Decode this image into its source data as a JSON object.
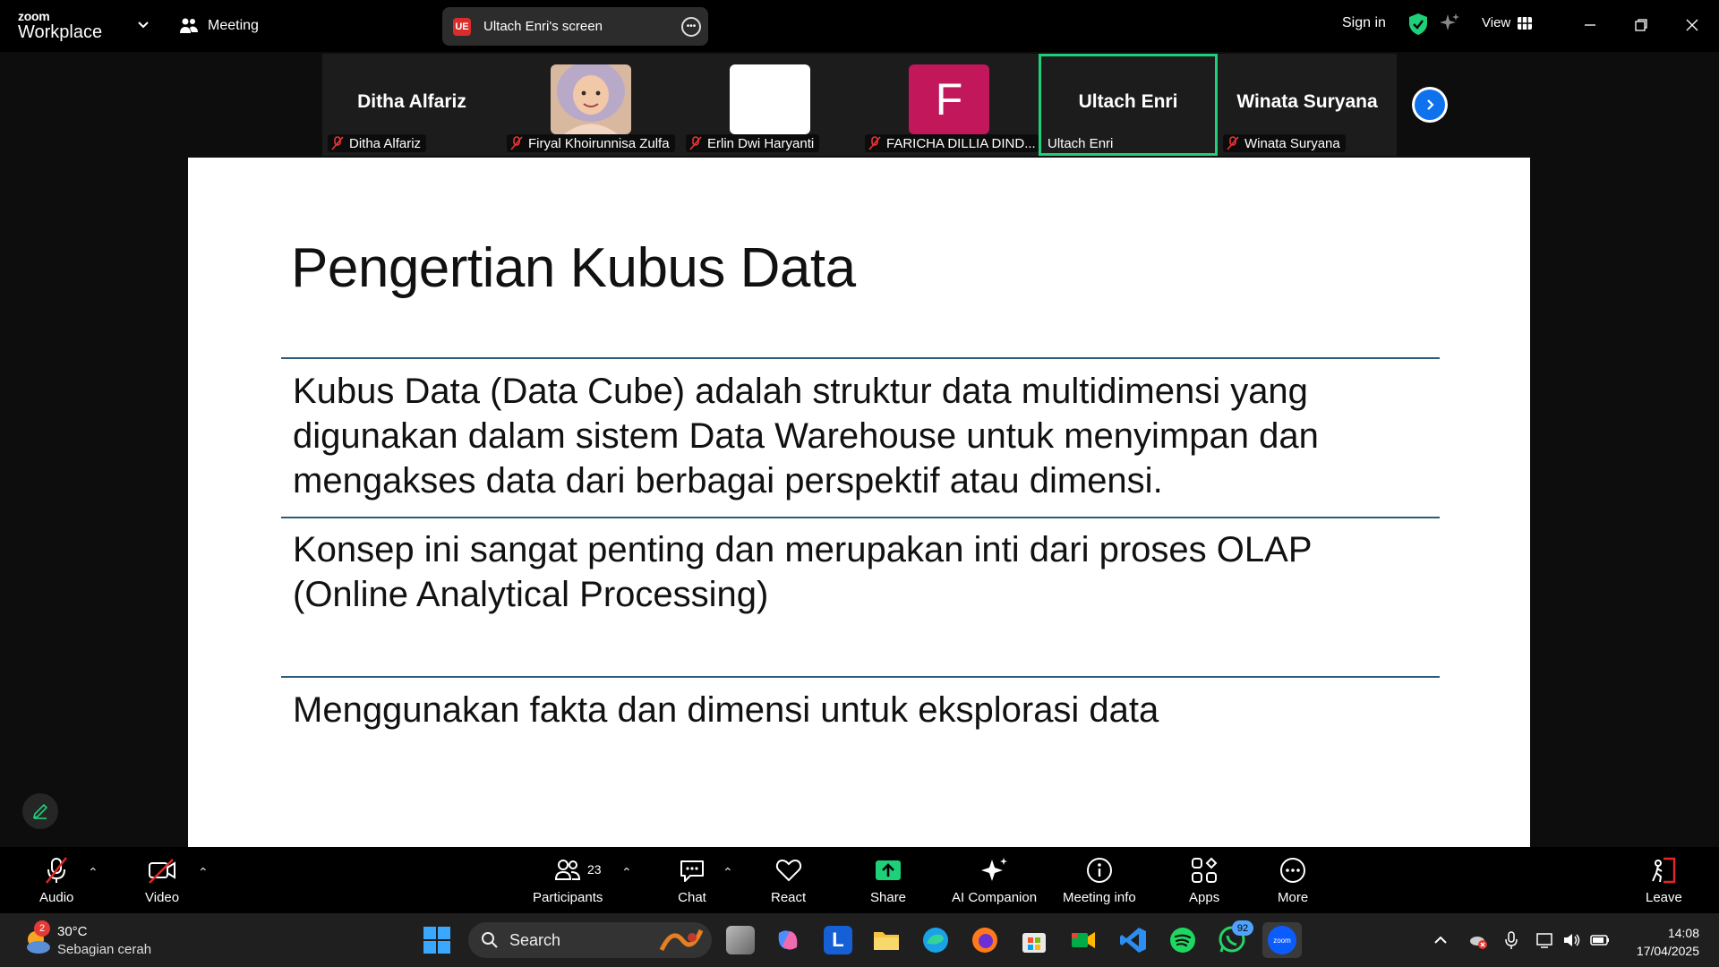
{
  "titlebar": {
    "brand_small": "zoom",
    "brand_big": "Workplace",
    "meeting_label": "Meeting",
    "share_badge": "UE",
    "share_label": "Ultach Enri's screen",
    "signin_label": "Sign in",
    "view_label": "View"
  },
  "participants_strip": {
    "tiles": [
      {
        "big_name": "Ditha Alfariz",
        "name": "Ditha Alfariz"
      },
      {
        "big_name": "",
        "name": "Firyal Khoirunnisa Zulfa"
      },
      {
        "big_name": "",
        "name": "Erlin Dwi Haryanti"
      },
      {
        "big_name": "",
        "initial": "F",
        "name": "FARICHA DILLIA DIND..."
      },
      {
        "big_name": "Ultach Enri",
        "name": "Ultach Enri"
      },
      {
        "big_name": "Winata Suryana",
        "name": "Winata Suryana"
      }
    ]
  },
  "slide": {
    "title": "Pengertian Kubus Data",
    "paragraphs": [
      "Kubus Data (Data Cube) adalah struktur data multidimensi yang digunakan dalam sistem Data Warehouse untuk menyimpan dan mengakses data dari berbagai perspektif atau dimensi.",
      "Konsep ini sangat penting dan merupakan inti dari proses OLAP (Online Analytical Processing)",
      "Menggunakan fakta dan dimensi untuk eksplorasi data"
    ]
  },
  "toolbar": {
    "audio": "Audio",
    "video": "Video",
    "participants": "Participants",
    "participants_count": "23",
    "chat": "Chat",
    "react": "React",
    "share": "Share",
    "ai_companion": "AI Companion",
    "meeting_info": "Meeting info",
    "apps": "Apps",
    "more": "More",
    "leave": "Leave"
  },
  "taskbar": {
    "weather_badge": "2",
    "temperature": "30°C",
    "weather_desc": "Sebagian cerah",
    "search_placeholder": "Search",
    "whatsapp_badge": "92",
    "zoom_label": "zoom",
    "time": "14:08",
    "date": "17/04/2025"
  },
  "colors": {
    "accent_green": "#1fd07a",
    "zoom_blue": "#0e72ed",
    "share_green": "#1fd07a",
    "leave_red": "#e02828",
    "slide_rule": "#2e5b7a"
  }
}
